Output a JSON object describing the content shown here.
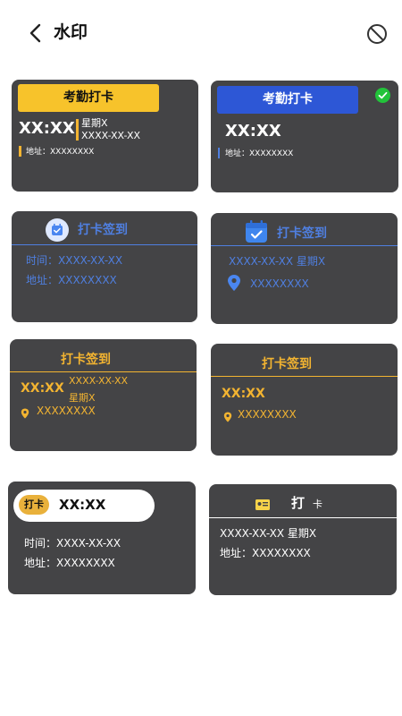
{
  "header": {
    "title": "水印",
    "back_icon": "chevron-left-icon",
    "no_watermark_icon": "ban-icon"
  },
  "colors": {
    "card_bg": "#444446",
    "yellow": "#f7c32b",
    "blue": "#2d57d6",
    "accent_blue": "#4f7fe0",
    "gold": "#f3b431",
    "check_green": "#22c33a"
  },
  "cards": {
    "c1": {
      "banner": "考勤打卡",
      "time": "XX:XX",
      "weekday": "星期X",
      "date": "XXXX-XX-XX",
      "address": "地址：XXXXXXXX"
    },
    "c2": {
      "banner": "考勤打卡",
      "time": "XX:XX",
      "address": "地址：XXXXXXXX",
      "selected_icon": "check-circle-icon"
    },
    "c3": {
      "title": "打卡签到",
      "time_row": "时间：XXXX-XX-XX",
      "address_row": "地址：XXXXXXXX",
      "icon": "calendar-check-icon"
    },
    "c4": {
      "title": "打卡签到",
      "date_week": "XXXX-XX-XX   星期X",
      "address": "XXXXXXXX",
      "icon": "calendar-check-icon",
      "pin_icon": "location-pin-icon"
    },
    "c5": {
      "title": "打卡签到",
      "time": "XX:XX",
      "date": "XXXX-XX-XX",
      "weekday": "星期X",
      "address": "XXXXXXXX"
    },
    "c6": {
      "title": "打卡签到",
      "time": "XX:XX",
      "address": "XXXXXXXX"
    },
    "c7": {
      "badge": "打卡",
      "time": "XX:XX",
      "time_row": "时间：XXXX-XX-XX",
      "address_row": "地址：XXXXXXXX"
    },
    "c8": {
      "title": "打",
      "title_small": "卡",
      "date_week": "XXXX-XX-XX  星期X",
      "address_row": "地址：XXXXXXXX",
      "icon": "id-card-icon"
    }
  }
}
